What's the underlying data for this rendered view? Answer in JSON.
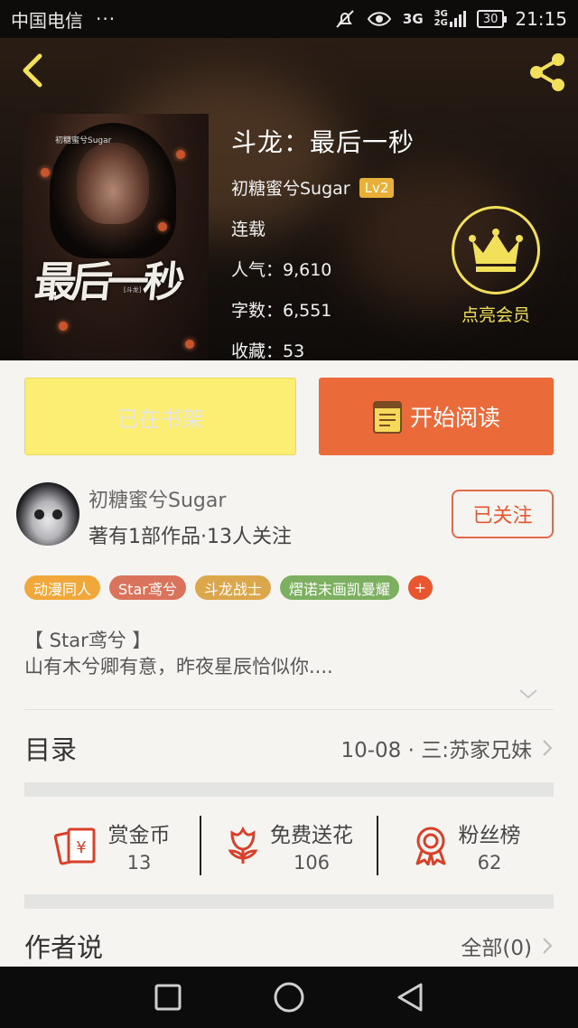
{
  "status_bar": {
    "carrier": "中国电信",
    "dots": "···",
    "net_main": "3G",
    "net_top": "3G",
    "net_bottom": "2G",
    "battery": "30",
    "time": "21:15"
  },
  "book": {
    "title": "斗龙：最后一秒",
    "author": "初糖蜜兮Sugar",
    "level": "Lv2",
    "status": "连载",
    "popularity": "人气：9,610",
    "word_count": "字数：6,551",
    "favorites": "收藏：53",
    "cover": {
      "title": "最后一秒",
      "series": "初糖蜜兮Sugar",
      "sub": "[斗龙]"
    }
  },
  "vip": {
    "label": "点亮会员"
  },
  "actions": {
    "shelf_label": "已在书架",
    "read_label": "开始阅读"
  },
  "author_card": {
    "name": "初糖蜜兮Sugar",
    "stats": "著有1部作品·13人关注",
    "follow_label": "已关注"
  },
  "tags": [
    {
      "label": "动漫同人",
      "color": "#f0a83a"
    },
    {
      "label": "Star鸢兮",
      "color": "#d9735c"
    },
    {
      "label": "斗龙战士",
      "color": "#dca64a"
    },
    {
      "label": "熠诺末画凯曼耀",
      "color": "#7cb060"
    }
  ],
  "tag_more": "+",
  "description": {
    "line1": "【 Star鸢兮 】",
    "line2": "山有木兮卿有意，昨夜星辰恰似你...."
  },
  "catalog": {
    "title": "目录",
    "latest": "10-08 · 三:苏家兄妹"
  },
  "rewards": [
    {
      "label": "赏金币",
      "value": "13",
      "icon": "red-envelope-icon"
    },
    {
      "label": "免费送花",
      "value": "106",
      "icon": "flower-icon"
    },
    {
      "label": "粉丝榜",
      "value": "62",
      "icon": "ribbon-badge-icon"
    }
  ],
  "author_say": {
    "title": "作者说",
    "all_label": "全部(0)"
  },
  "colors": {
    "accent": "#ea6a3a",
    "shelf": "#fbee72",
    "vip": "#f2e05a",
    "icon_red": "#d9402a"
  }
}
